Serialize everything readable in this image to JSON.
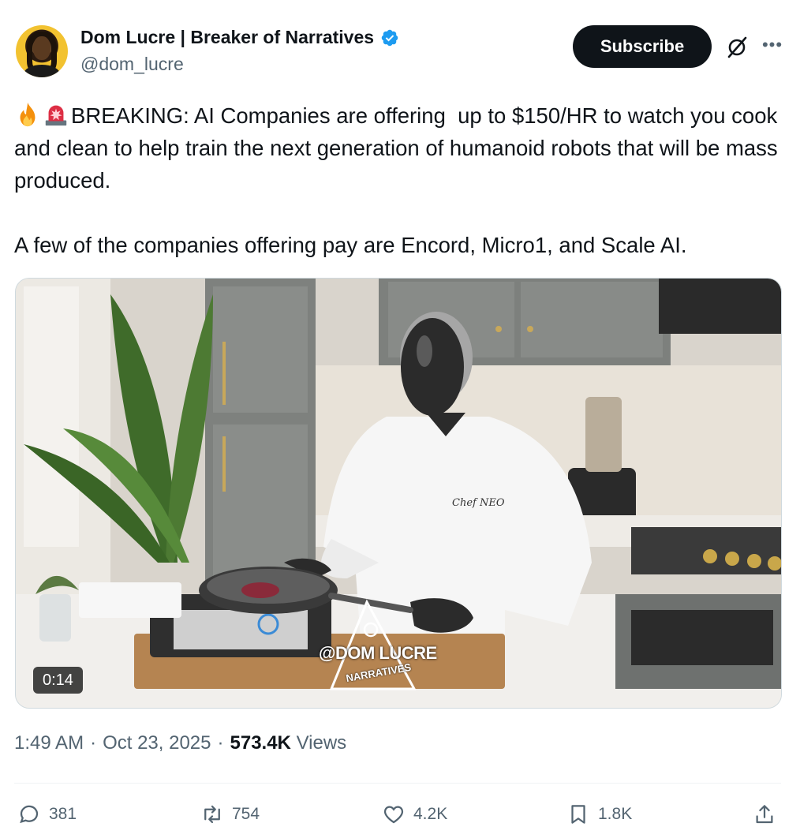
{
  "author": {
    "display_name": "Dom Lucre | Breaker of Narratives",
    "handle": "@dom_lucre",
    "verified": true,
    "verified_color": "#1d9bf0"
  },
  "header": {
    "subscribe_label": "Subscribe",
    "grok_icon": "grok-icon",
    "more_icon": "more-icon"
  },
  "tweet": {
    "paragraph_1": "BREAKING: AI Companies are offering  up to $150/HR to watch you cook and clean to help train the next generation of humanoid robots that will be mass produced.",
    "paragraph_2": "A few of the companies offering pay are Encord, Micro1, and Scale AI.",
    "emojis": [
      "fire-emoji",
      "siren-emoji"
    ]
  },
  "media": {
    "duration": "0:14",
    "apron_text": "Chef NEO",
    "watermark_top": "@DOM LUCRE",
    "watermark_bottom": "NARRATIVES"
  },
  "meta": {
    "time": "1:49 AM",
    "separator": "·",
    "date": "Oct 23, 2025",
    "views_count": "573.4K",
    "views_label": "Views"
  },
  "actions": {
    "replies": "381",
    "reposts": "754",
    "likes": "4.2K",
    "bookmarks": "1.8K"
  }
}
